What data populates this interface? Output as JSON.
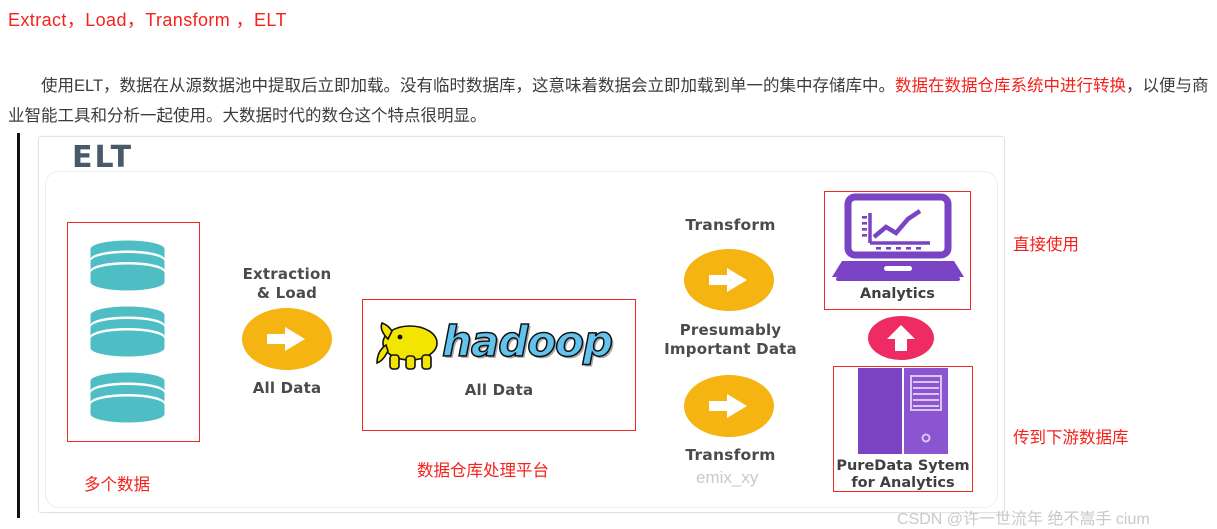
{
  "article": {
    "title": "Extract，Load，Transform ，ELT",
    "paragraph": {
      "part1": "使用ELT，数据在从源数据池中提取后立即加载。没有临时数据库，这意味着数据会立即加载到单一的集中存储库中。",
      "highlight": "数据在数据仓库系统中进行转换",
      "part2": "，以便与商业智能工具和分析一起使用。大数据时代的数仓这个特点很明显。"
    }
  },
  "diagram": {
    "heading": "ELT",
    "sources": {
      "annotation": "多个数据",
      "cylinder_count": 3,
      "cylinder_color": "#4FBEC4"
    },
    "extraction": {
      "caption_top": "Extraction\n& Load",
      "caption_top_line1": "Extraction",
      "caption_top_line2": "& Load",
      "caption_bottom": "All Data",
      "arrow_color": "#f5b411"
    },
    "platform": {
      "logo_text": "hadoop",
      "caption": "All Data",
      "annotation": "数据仓库处理平台",
      "logo_color": "#62c3ee",
      "elephant_color": "#f2e500"
    },
    "transform_upper": {
      "caption_top": "Transform",
      "caption_bottom_line1": "Presumably",
      "caption_bottom_line2": "Important Data"
    },
    "transform_lower": {
      "caption_bottom": "Transform"
    },
    "analytics": {
      "caption": "Analytics",
      "annotation": "直接使用",
      "device_color": "#7a43c4"
    },
    "uplink": {
      "arrow_color": "#ee2b63"
    },
    "puredata": {
      "caption_line1": "PureData Sytem",
      "caption_line2": "for Analytics",
      "annotation": "传到下游数据库",
      "device_color": "#7a43c4"
    }
  },
  "watermarks": {
    "inner": "emix_xy",
    "bottom": "CSDN @许一世流年 绝不嵩手 cium"
  },
  "colors": {
    "red": "#f5221b",
    "annotation_border": "#ee2a24",
    "heading": "#49596b",
    "teal": "#4FBEC4",
    "amber": "#f5b411",
    "purple": "#7a43c4",
    "pink": "#ee2b63"
  }
}
